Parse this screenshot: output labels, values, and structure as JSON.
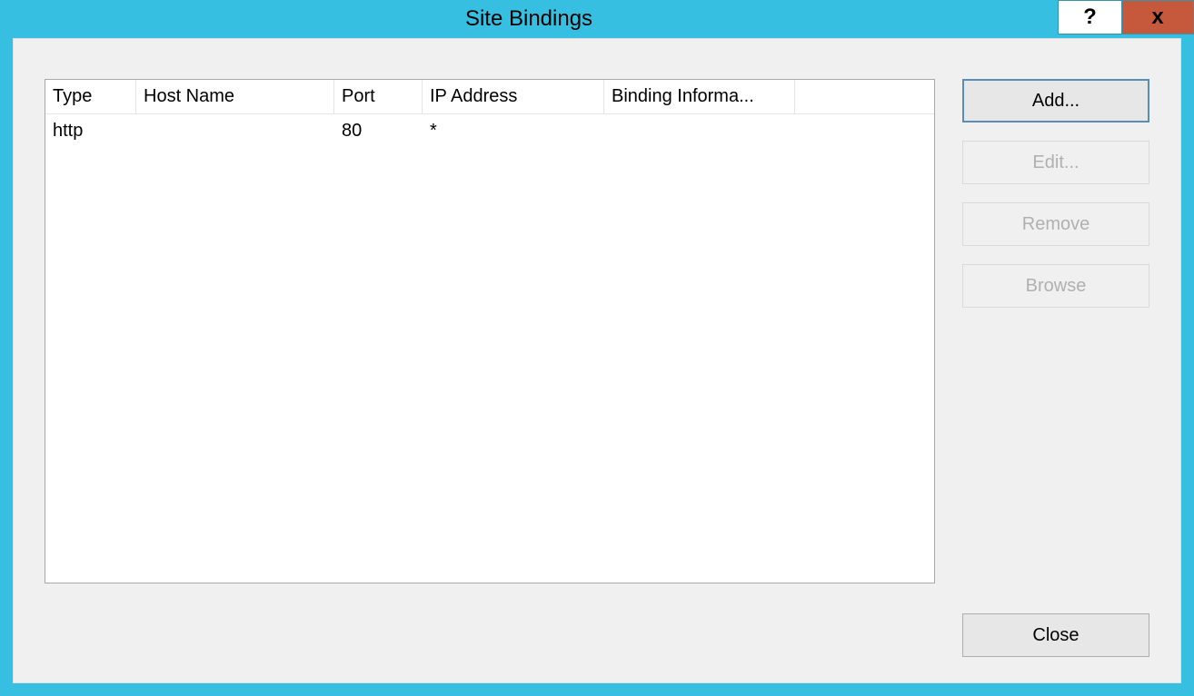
{
  "window": {
    "title": "Site Bindings",
    "help": "?",
    "close": "x"
  },
  "columns": {
    "type": "Type",
    "host": "Host Name",
    "port": "Port",
    "ip": "IP Address",
    "info": "Binding Informa..."
  },
  "rows": [
    {
      "type": "http",
      "host": "",
      "port": "80",
      "ip": "*",
      "info": ""
    }
  ],
  "buttons": {
    "add": "Add...",
    "edit": "Edit...",
    "remove": "Remove",
    "browse": "Browse",
    "close": "Close"
  }
}
